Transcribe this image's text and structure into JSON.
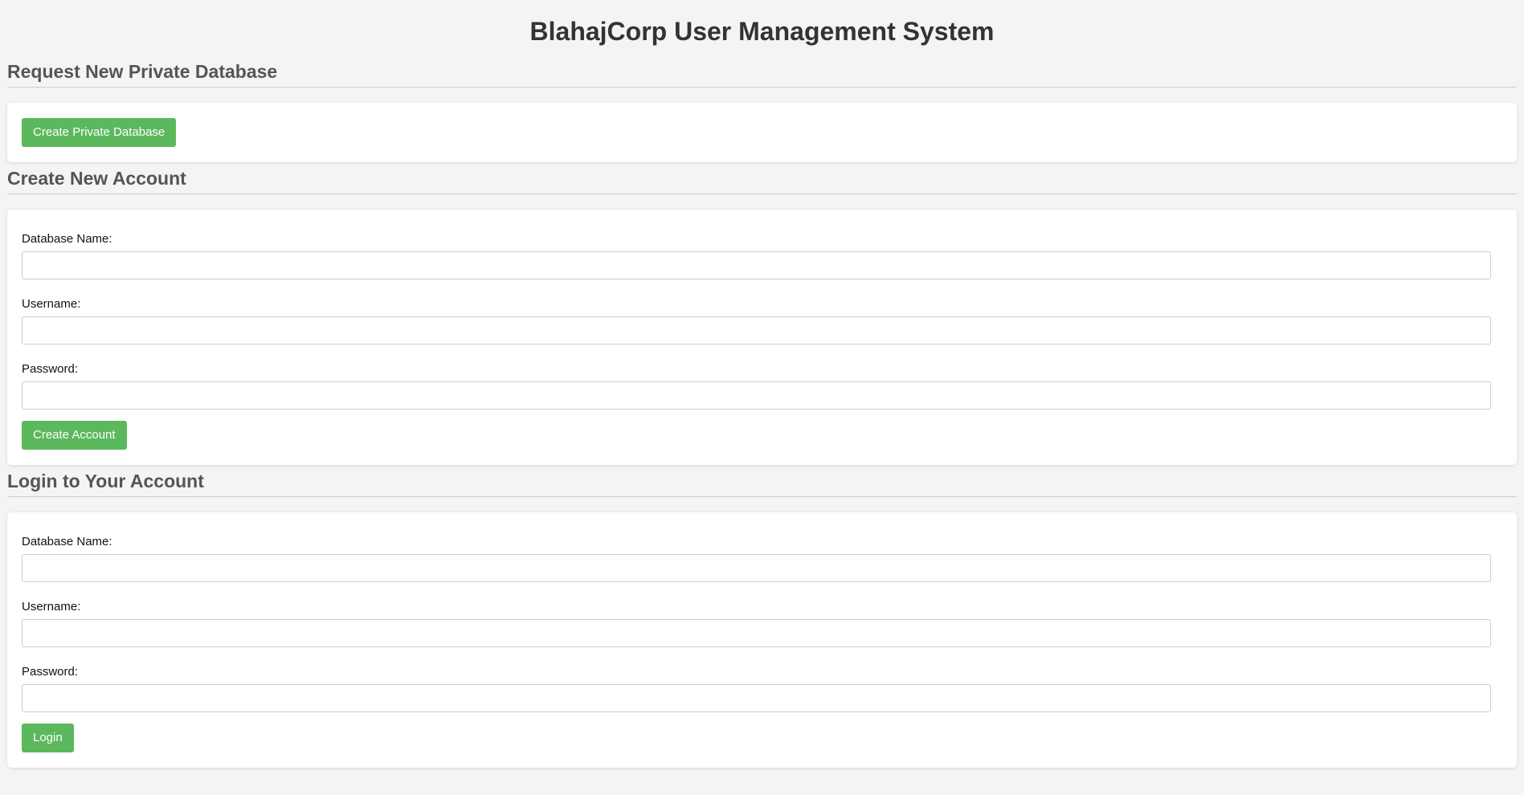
{
  "page": {
    "title": "BlahajCorp User Management System"
  },
  "request_db": {
    "heading": "Request New Private Database",
    "button_label": "Create Private Database"
  },
  "create_account": {
    "heading": "Create New Account",
    "database_label": "Database Name:",
    "username_label": "Username:",
    "password_label": "Password:",
    "database_value": "",
    "username_value": "",
    "password_value": "",
    "button_label": "Create Account"
  },
  "login": {
    "heading": "Login to Your Account",
    "database_label": "Database Name:",
    "username_label": "Username:",
    "password_label": "Password:",
    "database_value": "",
    "username_value": "",
    "password_value": "",
    "button_label": "Login"
  },
  "colors": {
    "background": "#f4f4f4",
    "card": "#ffffff",
    "button": "#5cb85c",
    "heading": "#555555"
  }
}
